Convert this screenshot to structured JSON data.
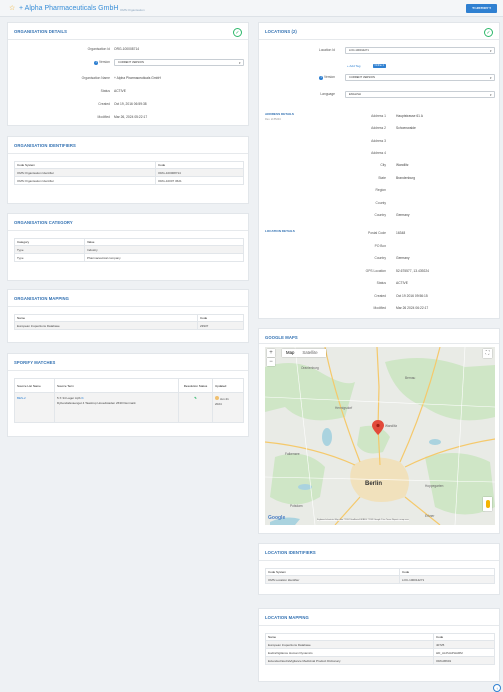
{
  "header": {
    "star": "☆",
    "title": "+ Alpha Pharmaceuticals GmbH",
    "subtitle": "OMS Organisation",
    "history_label": "⟲ HISTORY ▾"
  },
  "org_details": {
    "title": "ORGANISATION DETAILS",
    "badge": "✓",
    "fields": {
      "org_id_label": "Organisation Id",
      "org_id": "ORG-100008714",
      "version_label": "Version",
      "version": "CURRENT VERSION",
      "name_label": "Organisation Name",
      "name": "+ Alpha Pharmaceuticals GmbH",
      "status_label": "Status",
      "status": "ACTIVE",
      "created_label": "Created",
      "created": "Oct 19, 2016 06:59:38",
      "modified_label": "Modified",
      "modified": "Mar 26, 2024 05:22:17"
    }
  },
  "org_identifiers": {
    "title": "ORGANISATION IDENTIFIERS",
    "headers": [
      "Code System",
      "Code"
    ],
    "rows": [
      [
        "OMS Organisation Identifier",
        "ORG-100008714"
      ],
      [
        "OMS Organisation Identifier",
        "ORG-10007 3621"
      ]
    ]
  },
  "org_category": {
    "title": "ORGANISATION CATEGORY",
    "headers": [
      "Category",
      "Value"
    ],
    "rows": [
      [
        "Type",
        "Industry"
      ],
      [
        "Type",
        "Pharmaceutical company"
      ]
    ]
  },
  "org_mapping": {
    "title": "ORGANISATION MAPPING",
    "headers": [
      "Name",
      "Code"
    ],
    "rows": [
      [
        "European Inspections Database",
        "23937"
      ]
    ]
  },
  "spor_matches": {
    "title": "SPORIFY MATCHES",
    "headers": [
      "Source List Name",
      "Source Term",
      "Resolution Status",
      "Updated"
    ],
    "row": {
      "list": "BES-2",
      "term_line1": "5 X 34 Lager ApS",
      "term_line2": "Dybendalsvaenget 4 Taastrup Hovedstaden 2630 Denmark",
      "status": "✎",
      "updated_line1": "Jun 21",
      "updated_line2": "2024"
    }
  },
  "locations": {
    "title": "LOCATIONS (2)",
    "badge": "✓",
    "location_id_label": "Location Id",
    "location_id": "LOC-100014271",
    "add_tag": "+ Add Tag",
    "chip": "Online ✕",
    "version_label": "Version",
    "version": "CURRENT VERSION",
    "language_label": "Language",
    "language": "ENGLISH",
    "address_heading": "ADDRESS DETAILS",
    "address_sub": "Rev. id 85294",
    "address": {
      "a1_label": "Address 1",
      "a1": "Hauptstrasse 61 A",
      "a2_label": "Address 2",
      "a2": "Schoenwalde",
      "a3_label": "Address 3",
      "a3": "",
      "a4_label": "Address 4",
      "a4": "",
      "city_label": "City",
      "city": "Wandlitz",
      "state_label": "State",
      "state": "Brandenburg",
      "region_label": "Region",
      "region": "",
      "county_label": "County",
      "county": "",
      "country_label": "Country",
      "country": "Germany"
    },
    "location_heading": "LOCATION DETAILS",
    "details": {
      "postal_label": "Postal Code",
      "postal": "16348",
      "pobox_label": "PO Box",
      "pobox": "",
      "country_label": "Country",
      "country": "Germany",
      "gps_label": "GPS Location",
      "gps": "52.675577, 13.439224",
      "status_label": "Status",
      "status": "ACTIVE",
      "created_label": "Created",
      "created": "Oct 19 2016 09:56:15",
      "modified_label": "Modified",
      "modified": "Mar 26 2024 06:22:17"
    }
  },
  "google_maps": {
    "title": "GOOGLE MAPS",
    "map_tab": "Map",
    "satellite_tab": "Satellite",
    "zoom_in": "+",
    "zoom_out": "−",
    "fullscreen": "⛶",
    "city": "Berlin",
    "logo": "Google",
    "attribution": "Keyboard shortcuts   Map data ©2024 GeoBasis-DE/BKG ©2009 Google   5 km   Terms   Report a map error"
  },
  "location_identifiers": {
    "title": "LOCATION IDENTIFIERS",
    "headers": [
      "Code System",
      "Code"
    ],
    "rows": [
      [
        "OMS Location Identifier",
        "LOC-100014271"
      ]
    ]
  },
  "location_mapping": {
    "title": "LOCATION MAPPING",
    "headers": [
      "Name",
      "Code"
    ],
    "rows": [
      [
        "European Inspections Database",
        "40725"
      ],
      [
        "EudraVigilance Human Dynamics",
        "HD_ALPHAPHARM"
      ],
      [
        "Extended EudraVigilance Medicinal Product Dictionary",
        "ORG36601"
      ]
    ]
  },
  "colors": {
    "accent": "#2f6fb1",
    "primary": "#2f80d1",
    "success": "#2eb86b",
    "star": "#f0ad1e"
  }
}
